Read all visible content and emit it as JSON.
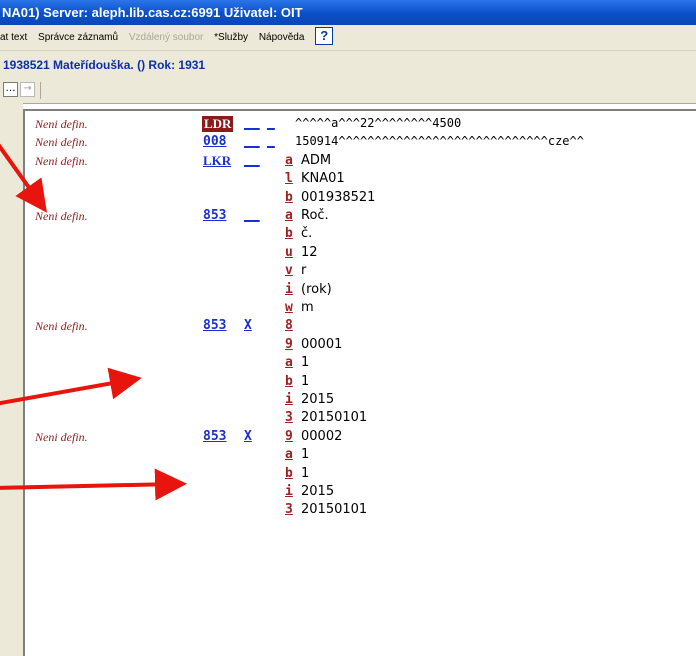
{
  "window": {
    "title": "NA01) Server: aleph.lib.cas.cz:6991  Uživatel: OIT"
  },
  "menu": {
    "items": [
      "at text",
      "Správce záznamů",
      "Vzdálený soubor",
      "*Služby",
      "Nápověda"
    ],
    "help_icon": "?"
  },
  "record": {
    "header": "1938521 Mateřídouška. () Rok: 1931"
  },
  "toolbar": {
    "btn_more": "…",
    "btn_next": "→"
  },
  "colors": {
    "label": "#8b1a1a",
    "tag": "#1a2fcf",
    "arrow": "#e8140e"
  },
  "fields": [
    {
      "label": "Neni defin.",
      "tag": "LDR",
      "ind1": "__",
      "ind2": "_",
      "sub": "",
      "value": "^^^^^a^^^22^^^^^^^^4500"
    },
    {
      "label": "Neni defin.",
      "tag": "008",
      "ind1": "__",
      "ind2": "_",
      "sub": "",
      "value": "150914^^^^^^^^^^^^^^^^^^^^^^^^^^^^^cze^^"
    },
    {
      "label": "Neni defin.",
      "tag": "LKR",
      "ind1": "__",
      "ind2": "",
      "sub": "a",
      "value": "ADM"
    },
    {
      "label": "",
      "tag": "",
      "ind1": "",
      "ind2": "",
      "sub": "l",
      "value": "KNA01"
    },
    {
      "label": "",
      "tag": "",
      "ind1": "",
      "ind2": "",
      "sub": "b",
      "value": "001938521"
    },
    {
      "label": "Neni defin.",
      "tag": "853",
      "ind1": "__",
      "ind2": "",
      "sub": "a",
      "value": "Roč."
    },
    {
      "label": "",
      "tag": "",
      "ind1": "",
      "ind2": "",
      "sub": "b",
      "value": "č."
    },
    {
      "label": "",
      "tag": "",
      "ind1": "",
      "ind2": "",
      "sub": "u",
      "value": "12"
    },
    {
      "label": "",
      "tag": "",
      "ind1": "",
      "ind2": "",
      "sub": "v",
      "value": "r"
    },
    {
      "label": "",
      "tag": "",
      "ind1": "",
      "ind2": "",
      "sub": "i",
      "value": "(rok)"
    },
    {
      "label": "",
      "tag": "",
      "ind1": "",
      "ind2": "",
      "sub": "w",
      "value": "m"
    },
    {
      "label": "Neni defin.",
      "tag": "853",
      "ind1": "X",
      "ind2": "",
      "sub": "8",
      "value": ""
    },
    {
      "label": "",
      "tag": "",
      "ind1": "",
      "ind2": "",
      "sub": "9",
      "value": "00001"
    },
    {
      "label": "",
      "tag": "",
      "ind1": "",
      "ind2": "",
      "sub": "a",
      "value": "1"
    },
    {
      "label": "",
      "tag": "",
      "ind1": "",
      "ind2": "",
      "sub": "b",
      "value": "1"
    },
    {
      "label": "",
      "tag": "",
      "ind1": "",
      "ind2": "",
      "sub": "i",
      "value": "2015"
    },
    {
      "label": "",
      "tag": "",
      "ind1": "",
      "ind2": "",
      "sub": "3",
      "value": "20150101"
    },
    {
      "label": "Neni defin.",
      "tag": "853",
      "ind1": "X",
      "ind2": "",
      "sub": "9",
      "value": "00002"
    },
    {
      "label": "",
      "tag": "",
      "ind1": "",
      "ind2": "",
      "sub": "a",
      "value": "1"
    },
    {
      "label": "",
      "tag": "",
      "ind1": "",
      "ind2": "",
      "sub": "b",
      "value": "1"
    },
    {
      "label": "",
      "tag": "",
      "ind1": "",
      "ind2": "",
      "sub": "i",
      "value": "2015"
    },
    {
      "label": "",
      "tag": "",
      "ind1": "",
      "ind2": "",
      "sub": "3",
      "value": "20150101"
    }
  ]
}
